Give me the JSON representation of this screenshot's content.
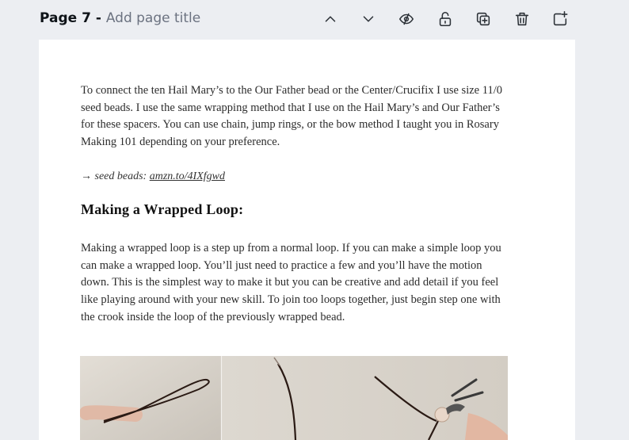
{
  "header": {
    "page_number": "Page 7 - ",
    "page_title_placeholder": "Add page title",
    "actions": [
      {
        "name": "move-up",
        "icon": "chevron-up-icon"
      },
      {
        "name": "move-down",
        "icon": "chevron-down-icon"
      },
      {
        "name": "hide-page",
        "icon": "eye-off-icon"
      },
      {
        "name": "lock-page",
        "icon": "lock-icon"
      },
      {
        "name": "duplicate-page",
        "icon": "duplicate-icon"
      },
      {
        "name": "delete-page",
        "icon": "trash-icon"
      },
      {
        "name": "add-page",
        "icon": "add-page-icon"
      }
    ]
  },
  "document": {
    "para1": "To connect the ten Hail Mary’s to the Our Father bead or the Center/Crucifix I use size 11/0 seed beads. I use the same wrapping method that I use on the Hail Mary’s and Our Father’s for these spacers. You can use chain, jump rings, or the bow method I taught you in Rosary Making 101 depending on your preference.",
    "link_prefix": "→ seed beads: ",
    "link_url": "amzn.to/4IXfgwd",
    "heading": "Making a Wrapped Loop:",
    "para2": "Making a wrapped loop is a step up from a normal loop. If you can make a simple loop you can make a wrapped loop. You’ll just need to practice a few and you’ll have the motion down. This is the simplest way to make it but you can be creative and add detail if you feel like playing around with your new skill. To join too loops together, just begin step one with the crook inside the loop of the previously wrapped bead."
  },
  "colors": {
    "canvas_bg": "#eceef2",
    "page_bg": "#ffffff",
    "text": "#2c2c2c",
    "muted": "#6b7280"
  }
}
